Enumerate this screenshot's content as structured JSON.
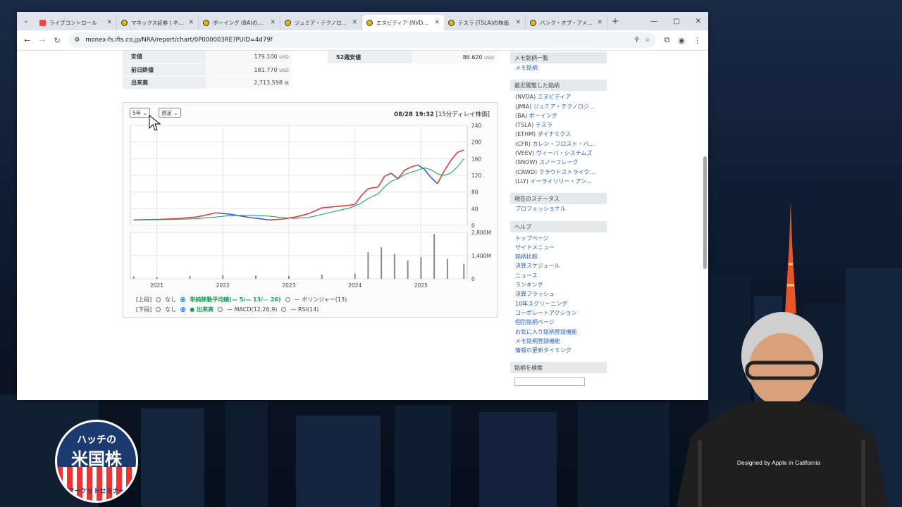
{
  "tabs": [
    {
      "title": "ライブコントロール",
      "icon": "red"
    },
    {
      "title": "マネックス証券 | ネット",
      "icon": "yellow"
    },
    {
      "title": "ボーイング (BA)の株価",
      "icon": "yellow"
    },
    {
      "title": "ジュミア・テクノロジーズ",
      "icon": "yellow"
    },
    {
      "title": "エヌビディア (NVDA)の",
      "icon": "yellow",
      "active": true
    },
    {
      "title": "テスラ (TSLA)の株価",
      "icon": "yellow"
    },
    {
      "title": "バンク・オブ・アメリカ (B",
      "icon": "yellow"
    }
  ],
  "address": {
    "url": "monex-fs.ifis.co.jp/NRA/report/chart/0P000003RE?PUID=4d79f"
  },
  "quote": {
    "rows": [
      {
        "label": "安値",
        "value": "179.100",
        "unit": "USD"
      },
      {
        "label": "前日終値",
        "value": "181.770",
        "unit": "USD"
      },
      {
        "label": "出来高",
        "value": "2,713,598",
        "unit": "株"
      }
    ],
    "right": {
      "label": "52週安値",
      "value": "86.620",
      "unit": "USD"
    }
  },
  "chart_controls": {
    "period": "5年",
    "interval": "週足",
    "timestamp": "08/28 19:32",
    "delay_note": "[15分ディレイ株価]",
    "upper_label": "[上段]",
    "lower_label": "[下段]",
    "none": "なし",
    "sma": "単純移動平均線(",
    "sma_5": "5",
    "sma_13": "13",
    "sma_26": "26",
    "sma_close": ")",
    "bollinger": "ボリンジャー(13)",
    "volume": "出来高",
    "macd": "MACD(12,26,9)",
    "rsi": "RSI(14)"
  },
  "chart_data": {
    "type": "line",
    "title": "",
    "x_ticks": [
      "2021",
      "2022",
      "2023",
      "2024",
      "2025"
    ],
    "price_axis": {
      "ticks": [
        0,
        40,
        80,
        120,
        160,
        200,
        240
      ],
      "ylim": [
        0,
        240
      ],
      "unit": "USD"
    },
    "volume_axis": {
      "ticks": [
        "0",
        "1,400M",
        "2,800M"
      ],
      "ylim": [
        0,
        2800
      ],
      "unit": "M"
    },
    "price_series": {
      "name": "",
      "x": [
        2020.65,
        2021.0,
        2021.3,
        2021.6,
        2021.9,
        2022.1,
        2022.4,
        2022.7,
        2022.9,
        2023.1,
        2023.3,
        2023.5,
        2023.7,
        2023.9,
        2024.0,
        2024.1,
        2024.2,
        2024.35,
        2024.45,
        2024.55,
        2024.65,
        2024.75,
        2024.85,
        2024.95,
        2025.05,
        2025.15,
        2025.25,
        2025.35,
        2025.45,
        2025.55,
        2025.65
      ],
      "y": [
        13,
        14,
        16,
        20,
        30,
        27,
        19,
        13,
        15,
        20,
        28,
        42,
        45,
        48,
        50,
        72,
        88,
        92,
        118,
        125,
        112,
        132,
        140,
        145,
        135,
        115,
        100,
        130,
        155,
        175,
        181
      ]
    },
    "volume_series": {
      "name": "出来高",
      "x": [
        2020.65,
        2021.0,
        2021.5,
        2022.0,
        2022.5,
        2023.0,
        2023.5,
        2024.0,
        2024.2,
        2024.4,
        2024.6,
        2024.8,
        2025.0,
        2025.2,
        2025.4,
        2025.65
      ],
      "y": [
        150,
        120,
        180,
        220,
        200,
        180,
        260,
        320,
        1600,
        1900,
        1500,
        1100,
        1300,
        2700,
        1200,
        900
      ]
    }
  },
  "sidebar": {
    "memo_header": "メモ銘柄一覧",
    "memo_link": "メモ銘柄",
    "recent_header": "最近閲覧した銘柄",
    "recent": [
      {
        "ticker": "(NVDA)",
        "name": "エヌビディア"
      },
      {
        "ticker": "(JMIA)",
        "name": "ジュミア・テクノロジ…"
      },
      {
        "ticker": "(BA)",
        "name": "ボーイング"
      },
      {
        "ticker": "(TSLA)",
        "name": "テスラ"
      },
      {
        "ticker": "(ETHM)",
        "name": "ダイナミクス"
      },
      {
        "ticker": "(CFR)",
        "name": "カレン・フロスト・バ…"
      },
      {
        "ticker": "(VEEV)",
        "name": "ヴィーバ・システムズ"
      },
      {
        "ticker": "(SNOW)",
        "name": "スノーフレーク"
      },
      {
        "ticker": "(CRWD)",
        "name": "クラウドストライク…"
      },
      {
        "ticker": "(LLY)",
        "name": "イーライリリー・アン…"
      }
    ],
    "status_header": "現在のステータス",
    "status_link": "プロフェッショナル",
    "help_header": "ヘルプ",
    "help_links": [
      "トップページ",
      "サイドメニュー",
      "銘柄比較",
      "決算スケジュール",
      "ニュース",
      "ランキング",
      "決算フラッシュ",
      "10年スクリーニング",
      "コーポレートアクション",
      "個別銘柄ページ",
      "お気に入り銘柄登録機能",
      "メモ銘柄登録機能",
      "情報の更新タイミング"
    ],
    "search_header": "銘柄を検索"
  },
  "logo": {
    "line1": "ハッチの",
    "line2": "米国株",
    "line3": "マーケットセミナー"
  },
  "shirt_text": "Designed by Apple in California",
  "colors": {
    "up": "#e23b3b",
    "down": "#3b5bd8",
    "sma5": "#1a9a5a",
    "sma13": "#1a9a5a",
    "link": "#2a5fb0"
  }
}
